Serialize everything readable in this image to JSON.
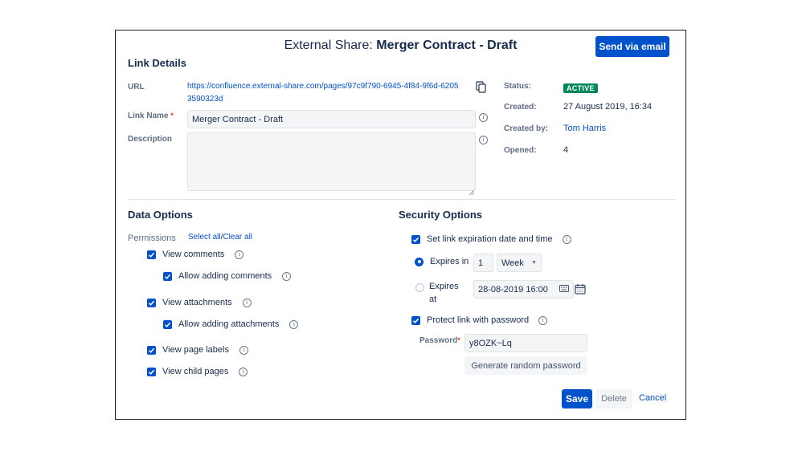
{
  "dialog": {
    "title_prefix": "External Share: ",
    "title_name": "Merger Contract - Draft",
    "send_button": "Send via email"
  },
  "link_details": {
    "section_title": "Link Details",
    "url_label": "URL",
    "url_value": "https://confluence.external-share.com/pages/97c9f790-6945-4f84-9f6d-62053590323d",
    "link_name_label": "Link Name",
    "link_name_value": "Merger Contract - Draft",
    "description_label": "Description",
    "description_value": ""
  },
  "meta": {
    "status_label": "Status:",
    "status_value": "ACTIVE",
    "created_label": "Created:",
    "created_value": "27 August 2019, 16:34",
    "created_by_label": "Created by:",
    "created_by_value": "Tom Harris",
    "opened_label": "Opened:",
    "opened_value": "4"
  },
  "data_options": {
    "section_title": "Data Options",
    "permissions_label": "Permissions",
    "select_all": "Select all",
    "separator": "/",
    "clear_all": "Clear all",
    "items": [
      {
        "label": "View comments",
        "checked": true
      },
      {
        "label": "Allow adding comments",
        "checked": true
      },
      {
        "label": "View attachments",
        "checked": true
      },
      {
        "label": "Allow adding attachments",
        "checked": true
      },
      {
        "label": "View page labels",
        "checked": true
      },
      {
        "label": "View child pages",
        "checked": true
      }
    ]
  },
  "security_options": {
    "section_title": "Security Options",
    "expiration_label": "Set link expiration date and time",
    "expires_in_label": "Expires in",
    "expires_in_value": "1",
    "expires_in_unit": "Week",
    "expires_at_label_1": "Expires",
    "expires_at_label_2": "at",
    "expires_at_value": "28-08-2019 16:00",
    "protect_label": "Protect link with password",
    "password_label": "Password",
    "password_value": "y8OZK~Lq",
    "generate_button": "Generate random password"
  },
  "footer": {
    "save": "Save",
    "delete": "Delete",
    "cancel": "Cancel"
  },
  "colors": {
    "primary": "#0052cc",
    "active_badge": "#00875a",
    "required": "#de350b"
  }
}
